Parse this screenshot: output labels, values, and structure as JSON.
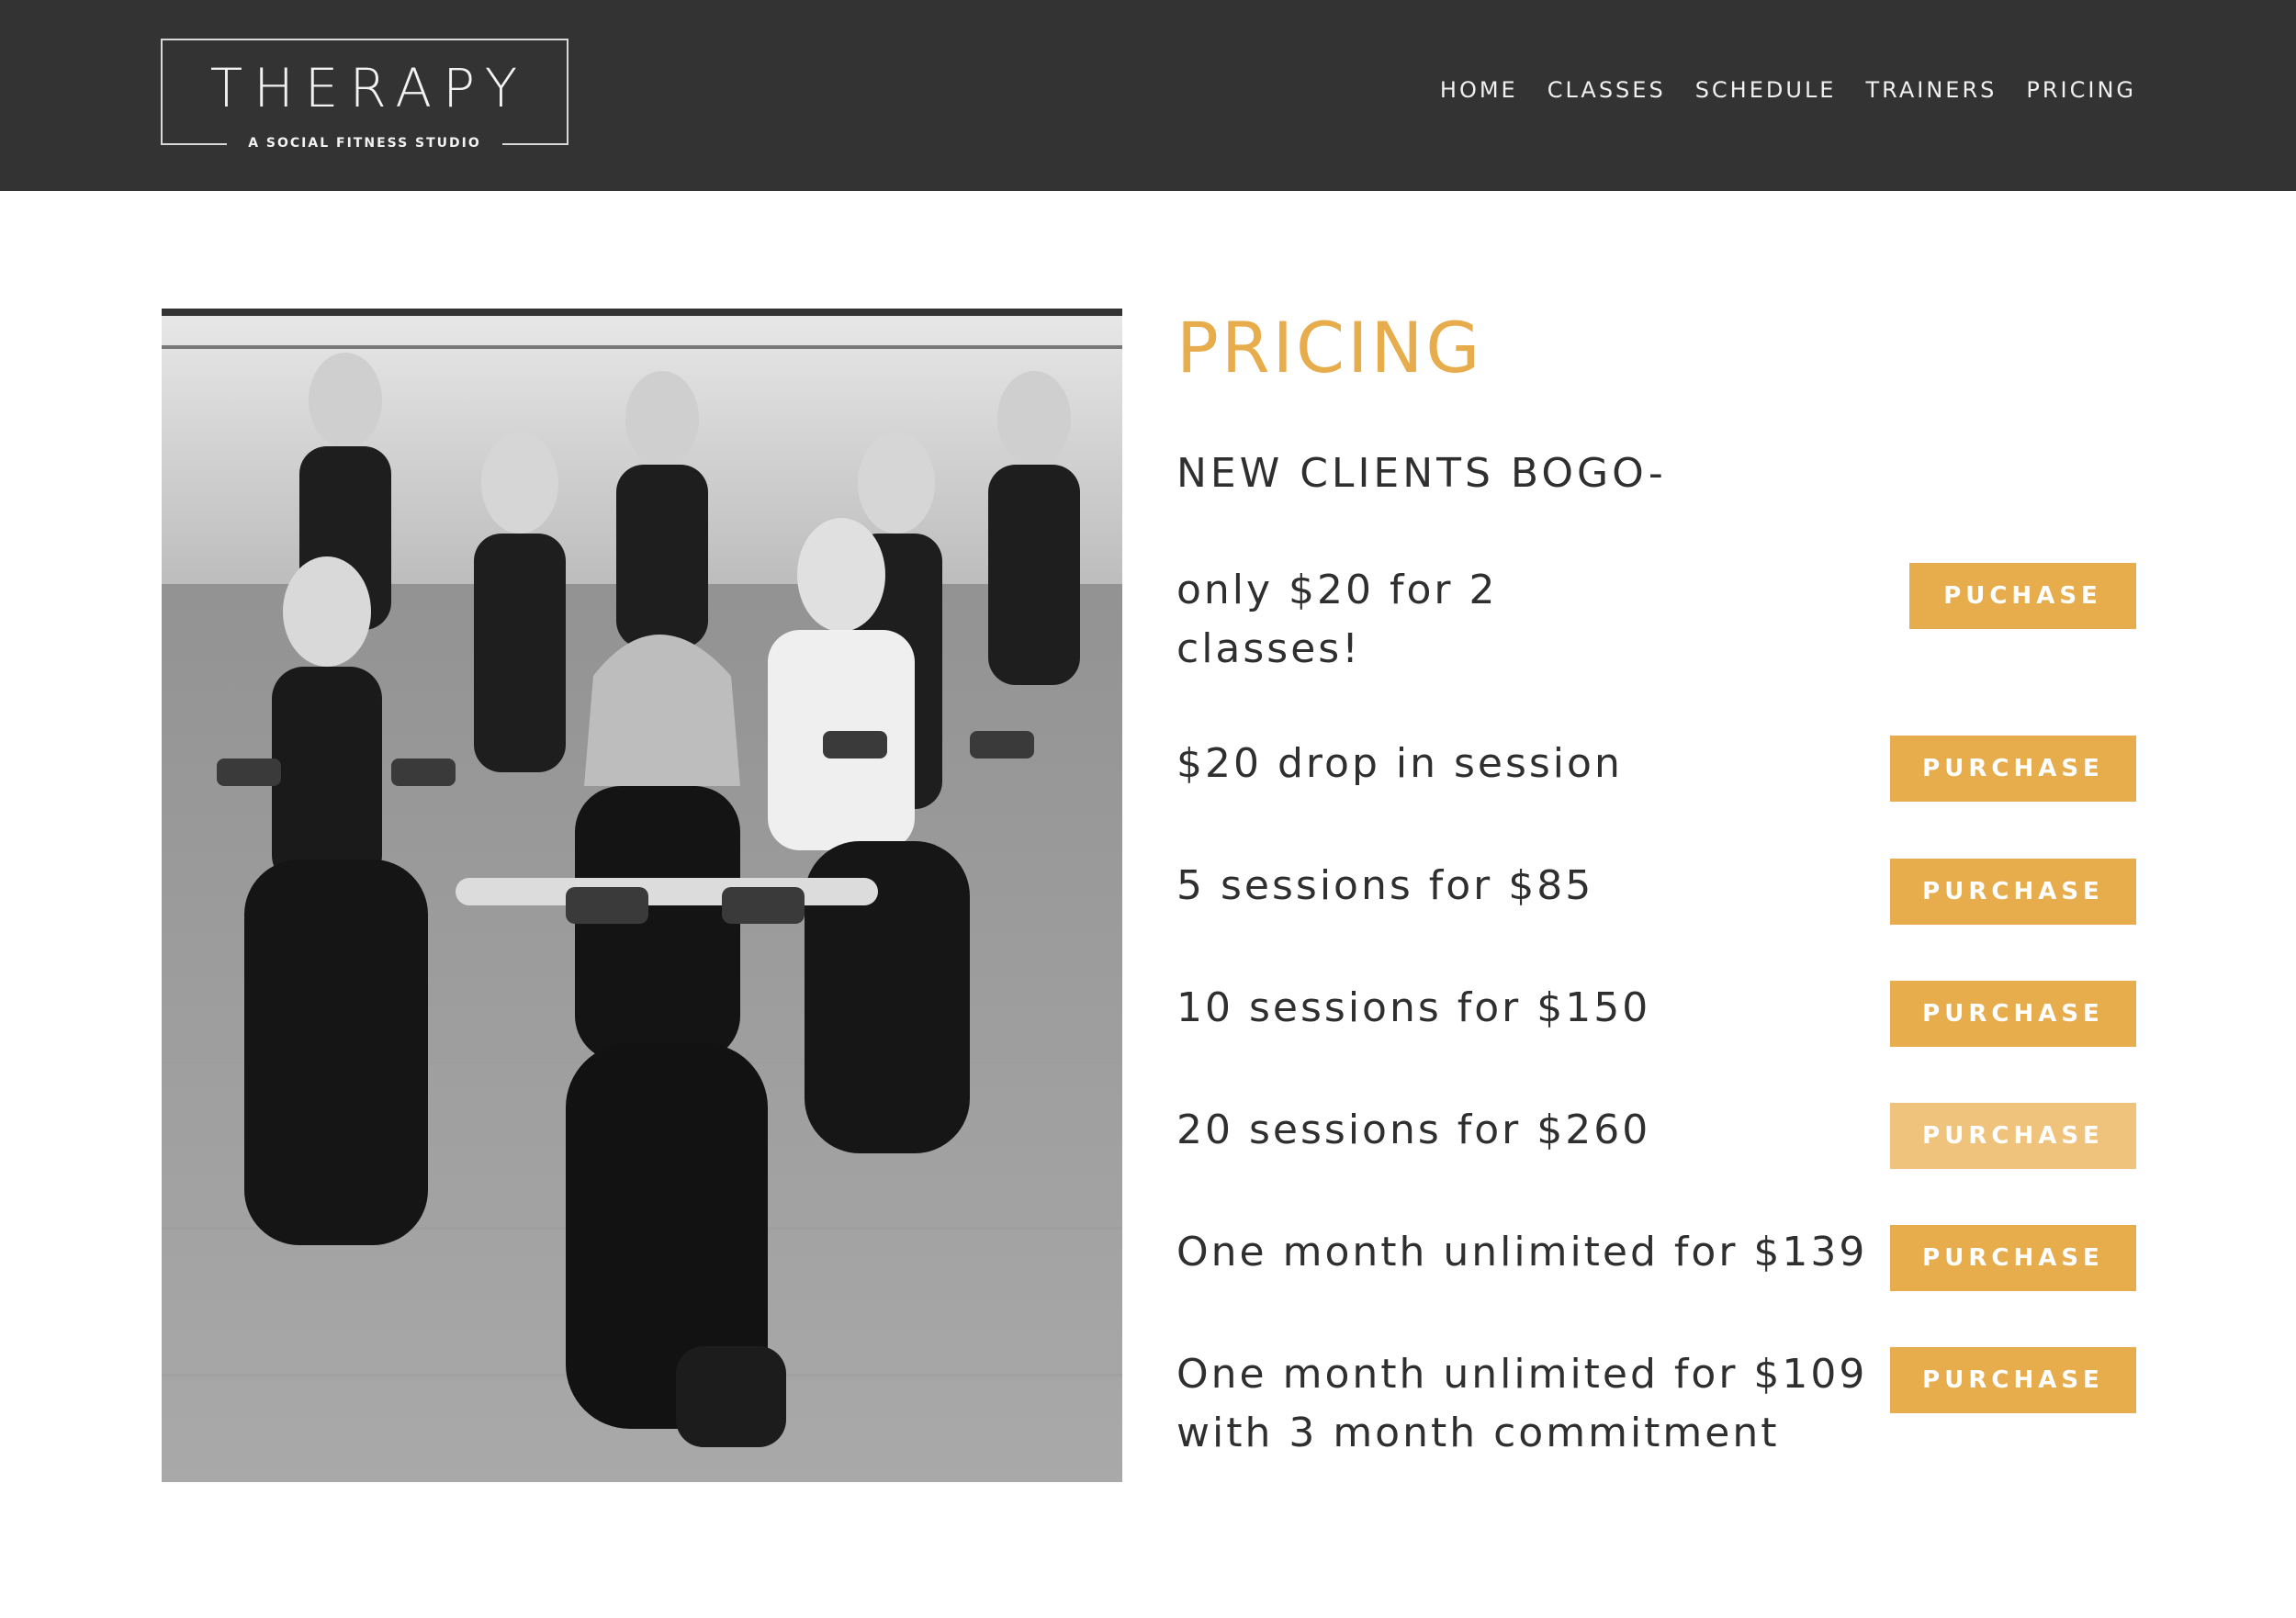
{
  "header": {
    "logo_title": "THERAPY",
    "logo_subtitle": "A SOCIAL FITNESS STUDIO",
    "nav": [
      "HOME",
      "CLASSES",
      "SCHEDULE",
      "TRAINERS",
      "PRICING"
    ]
  },
  "main": {
    "title": "PRICING",
    "subtitle": "NEW CLIENTS BOGO-",
    "items": [
      {
        "line1": "only $20 for 2",
        "line2": "classes!",
        "button": "PUCHASE"
      },
      {
        "line1": "$20 drop in session",
        "button": "PURCHASE"
      },
      {
        "line1": "5 sessions for $85",
        "button": "PURCHASE"
      },
      {
        "line1": "10 sessions for $150",
        "button": "PURCHASE"
      },
      {
        "line1": "20 sessions for $260",
        "button": "PURCHASE"
      },
      {
        "line1": "One month unlimited for $139",
        "button": "PURCHASE"
      },
      {
        "line1": "One month unlimited for $109",
        "line2": "with 3 month commitment",
        "button": "PURCHASE"
      }
    ]
  },
  "colors": {
    "header_bg": "#333333",
    "accent": "#e7ac4c",
    "accent_hover": "#f0c37c",
    "text": "#2f2f2f"
  },
  "image": {
    "icon": "photo-fitness-class",
    "style": "black-and-white"
  }
}
